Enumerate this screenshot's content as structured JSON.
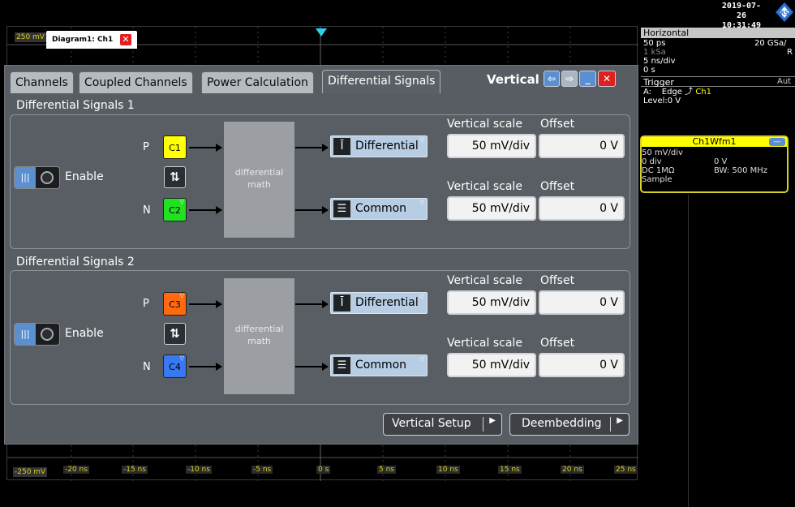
{
  "topbar": {
    "date": "2019-07-26",
    "time": "10:31:49",
    "logo_icon": "rs-logo-icon"
  },
  "waveform": {
    "diagram_tab": "Diagram1: Ch1",
    "y_top": "250 mV",
    "y_bottom": "-250 mV",
    "x_ticks": [
      "-20 ns",
      "-15 ns",
      "-10 ns",
      "-5 ns",
      "0 s",
      "5 ns",
      "10 ns",
      "15 ns",
      "20 ns",
      "25 ns"
    ],
    "trace_color": "#d8d020"
  },
  "dialog": {
    "tabs": [
      "Channels",
      "Coupled Channels",
      "Power Calculation",
      "Differential Signals"
    ],
    "active_tab": "Differential Signals",
    "title": "Vertical",
    "groups": [
      {
        "title": "Differential Signals 1",
        "enable_label": "Enable",
        "p_label": "P",
        "n_label": "N",
        "p_channel": "C1",
        "n_channel": "C2",
        "p_color": "#ffff00",
        "n_color": "#22e022",
        "math_label": "differential math",
        "diff_label": "Differential",
        "common_label": "Common",
        "hdr_scale": "Vertical scale",
        "hdr_offset": "Offset",
        "diff_scale": "50 mV/div",
        "diff_offset": "0 V",
        "common_scale": "50 mV/div",
        "common_offset": "0 V"
      },
      {
        "title": "Differential Signals 2",
        "enable_label": "Enable",
        "p_label": "P",
        "n_label": "N",
        "p_channel": "C3",
        "n_channel": "C4",
        "p_color": "#ff6a10",
        "n_color": "#3878f0",
        "math_label": "differential math",
        "diff_label": "Differential",
        "common_label": "Common",
        "hdr_scale": "Vertical scale",
        "hdr_offset": "Offset",
        "diff_scale": "50 mV/div",
        "diff_offset": "0 V",
        "common_scale": "50 mV/div",
        "common_offset": "0 V"
      }
    ],
    "footer": {
      "vertical_setup": "Vertical Setup",
      "deembedding": "Deembedding"
    }
  },
  "right_panel": {
    "horizontal": {
      "title": "Horizontal",
      "resolution": "50 ps",
      "sample_rate": "20 GSa/",
      "record_length": "1 kSa",
      "mode": "R",
      "time_scale": "5 ns/div",
      "position": "0 s"
    },
    "trigger": {
      "title": "Trigger",
      "mode": "Aut",
      "source_prefix": "A:",
      "type": "Edge",
      "source": "Ch1",
      "level": "Level:0 V"
    },
    "channel": {
      "title": "Ch1Wfm1",
      "scale": "50 mV/div",
      "position": "0 div",
      "offset": "0 V",
      "coupling": "DC 1MΩ",
      "bandwidth": "BW: 500 MHz",
      "acq_mode": "Sample"
    }
  }
}
